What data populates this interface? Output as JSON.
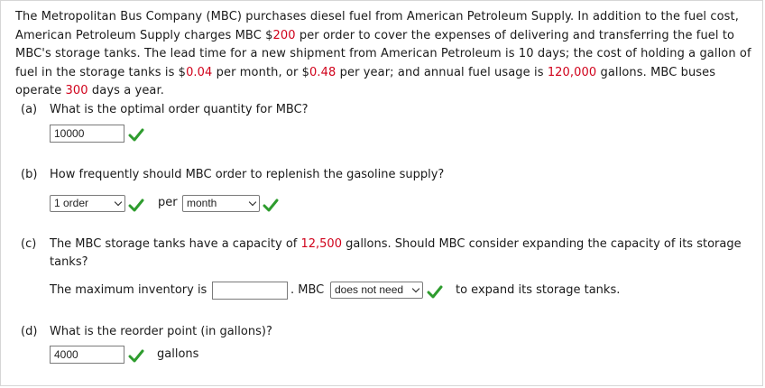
{
  "intro": {
    "t1": "The Metropolitan Bus Company (MBC) purchases diesel fuel from American Petroleum Supply. In addition to the fuel cost, American Petroleum Supply charges MBC $",
    "order_cost": "200",
    "t2": " per order to cover the expenses of delivering and transferring the fuel to MBC's storage tanks. The lead time for a new shipment from American Petroleum is 10 days; the cost of holding a gallon of fuel in the storage tanks is $",
    "holding_month": "0.04",
    "t3": " per month, or $",
    "holding_year": "0.48",
    "t4": " per year; and annual fuel usage is ",
    "annual_usage": "120,000",
    "t5": " gallons. MBC buses operate ",
    "days": "300",
    "t6": " days a year."
  },
  "a": {
    "label": "(a)",
    "question": "What is the optimal order quantity for MBC?",
    "answer": "10000"
  },
  "b": {
    "label": "(b)",
    "question": "How frequently should MBC order to replenish the gasoline supply?",
    "select1": "1 order",
    "per": "per",
    "select2": "month"
  },
  "c": {
    "label": "(c)",
    "q1": "The MBC storage tanks have a capacity of ",
    "capacity": "12,500",
    "q2": " gallons. Should MBC consider expanding the capacity of its storage tanks?",
    "max_inv_label": "The maximum inventory is",
    "max_inv_value": "",
    "mbc_label": ". MBC",
    "select": "does not need",
    "tail": "to expand its storage tanks."
  },
  "d": {
    "label": "(d)",
    "question": "What is the reorder point (in gallons)?",
    "answer": "4000",
    "unit": "gallons"
  },
  "colors": {
    "highlight": "#d0021b",
    "check": "#2e9c2e"
  }
}
